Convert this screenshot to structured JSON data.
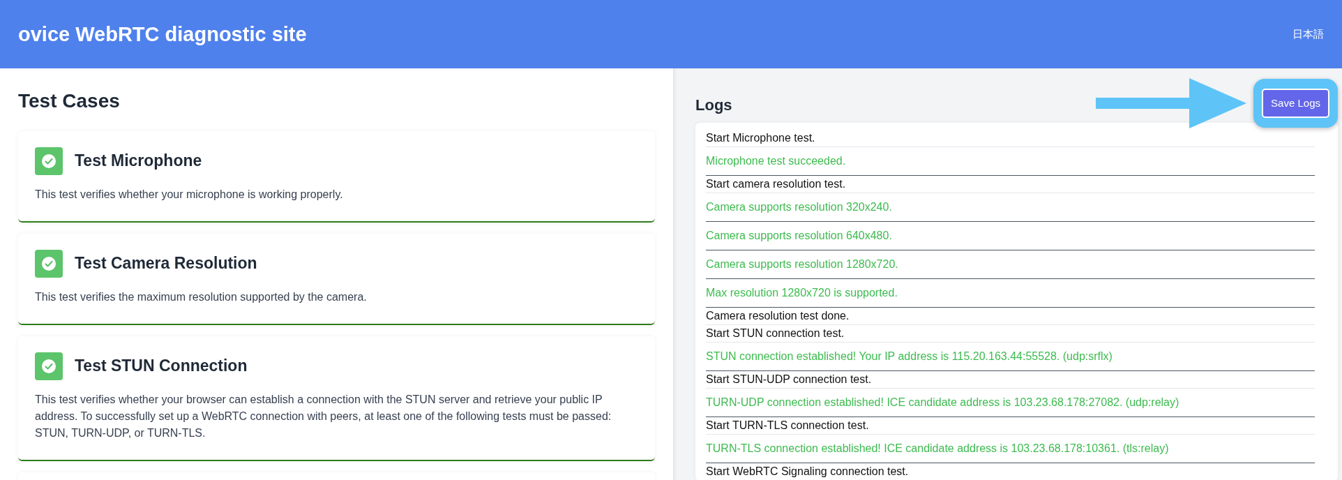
{
  "header": {
    "title": "ovice WebRTC diagnostic site",
    "language_link": "日本語"
  },
  "test_cases": {
    "heading": "Test Cases",
    "cards": [
      {
        "title": "Test Microphone",
        "description": "This test verifies whether your microphone is working properly.",
        "passed": true
      },
      {
        "title": "Test Camera Resolution",
        "description": "This test verifies the maximum resolution supported by the camera.",
        "passed": true
      },
      {
        "title": "Test STUN Connection",
        "description": "This test verifies whether your browser can establish a connection with the STUN server and retrieve your public IP address. To successfully set up a WebRTC connection with peers, at least one of the following tests must be passed: STUN, TURN-UDP, or TURN-TLS.",
        "passed": true
      }
    ]
  },
  "logs": {
    "heading": "Logs",
    "save_button": "Save Logs",
    "entries": [
      {
        "kind": "info",
        "text": "Start Microphone test."
      },
      {
        "kind": "success",
        "text": "Microphone test succeeded."
      },
      {
        "kind": "info",
        "text": "Start camera resolution test."
      },
      {
        "kind": "success",
        "text": "Camera supports resolution 320x240."
      },
      {
        "kind": "success",
        "text": "Camera supports resolution 640x480."
      },
      {
        "kind": "success",
        "text": "Camera supports resolution 1280x720."
      },
      {
        "kind": "success",
        "text": "Max resolution 1280x720 is supported."
      },
      {
        "kind": "info",
        "text": "Camera resolution test done."
      },
      {
        "kind": "info",
        "text": "Start STUN connection test."
      },
      {
        "kind": "success",
        "text": "STUN connection established! Your IP address is 115.20.163.44:55528. (udp:srflx)"
      },
      {
        "kind": "info",
        "text": "Start STUN-UDP connection test."
      },
      {
        "kind": "success",
        "text": "TURN-UDP connection established! ICE candidate address is 103.23.68.178:27082. (udp:relay)"
      },
      {
        "kind": "info",
        "text": "Start TURN-TLS connection test."
      },
      {
        "kind": "success",
        "text": "TURN-TLS connection established! ICE candidate address is 103.23.68.178:10361. (tls:relay)"
      },
      {
        "kind": "info",
        "text": "Start WebRTC Signaling connection test."
      }
    ]
  }
}
